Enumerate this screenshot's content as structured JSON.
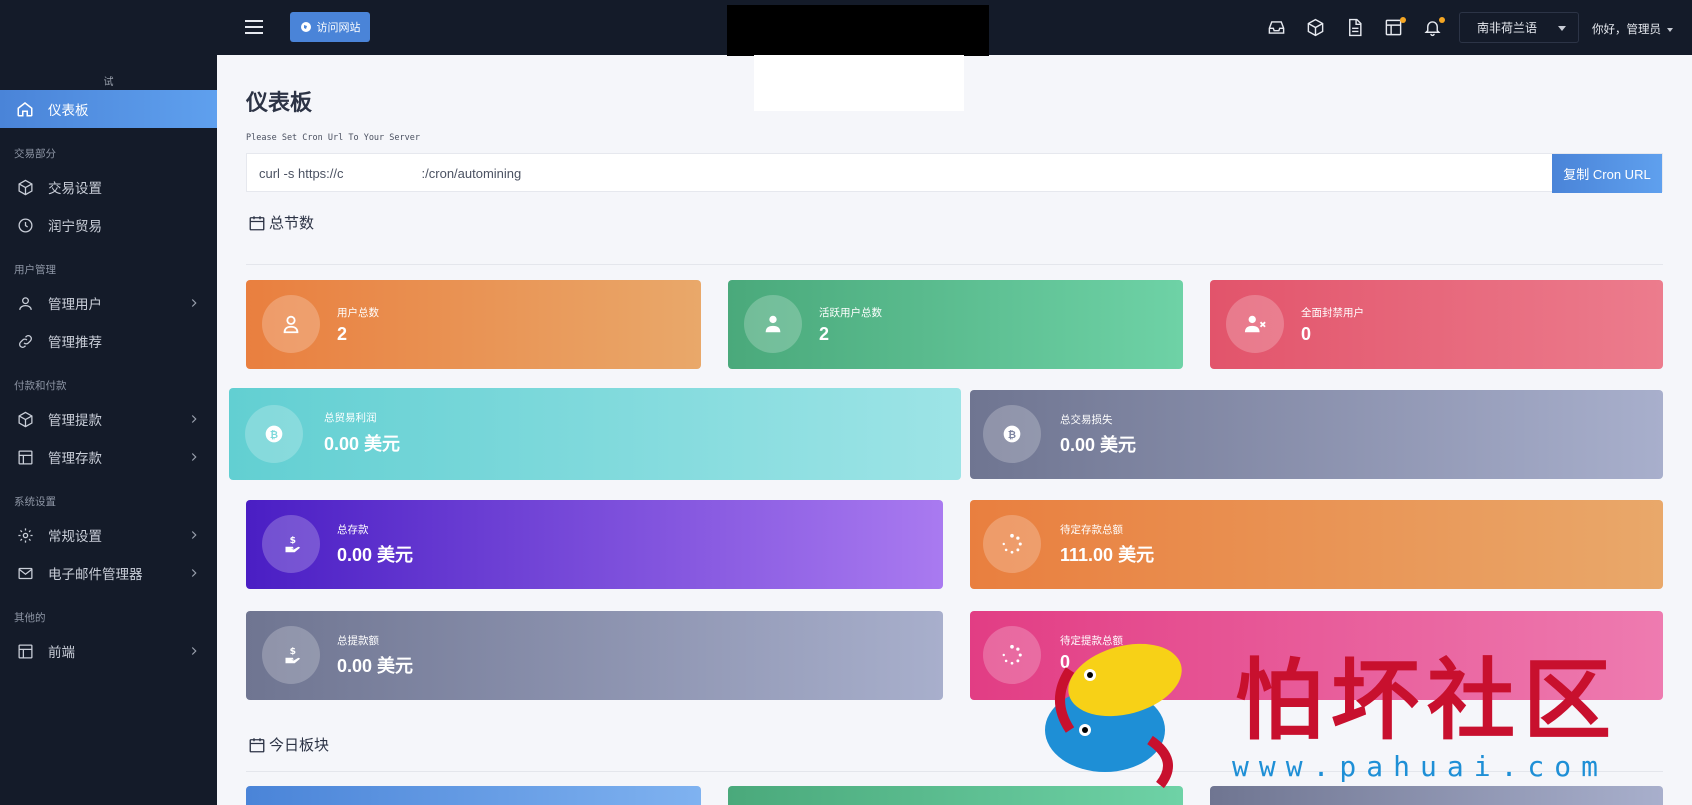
{
  "brand": {
    "label": "试"
  },
  "sidebar": {
    "active": {
      "label": "仪表板",
      "icon": "home-icon"
    },
    "sections": [
      {
        "title": "交易部分",
        "items": [
          {
            "label": "交易设置",
            "icon": "cube-icon",
            "chevron": false
          },
          {
            "label": "润宁贸易",
            "icon": "clock-icon",
            "chevron": false
          }
        ]
      },
      {
        "title": "用户管理",
        "items": [
          {
            "label": "管理用户",
            "icon": "user-icon",
            "chevron": true
          },
          {
            "label": "管理推荐",
            "icon": "link-icon",
            "chevron": false
          }
        ]
      },
      {
        "title": "付款和付款",
        "items": [
          {
            "label": "管理提款",
            "icon": "cube-icon",
            "chevron": true
          },
          {
            "label": "管理存款",
            "icon": "table-icon",
            "chevron": true
          }
        ]
      },
      {
        "title": "系统设置",
        "items": [
          {
            "label": "常规设置",
            "icon": "gear-icon",
            "chevron": true
          },
          {
            "label": "电子邮件管理器",
            "icon": "mail-icon",
            "chevron": true
          }
        ]
      },
      {
        "title": "其他的",
        "items": [
          {
            "label": "前端",
            "icon": "table-icon",
            "chevron": true
          }
        ]
      }
    ]
  },
  "topbar": {
    "visit_label": "访问网站",
    "language": "南非荷兰语",
    "greeting": "你好，管理员"
  },
  "page": {
    "title": "仪表板",
    "cron_note": "Please Set Cron Url To Your Server",
    "cron_prefix": "curl -s https://c",
    "cron_suffix": ":/cron/automining",
    "cron_button": "复制 Cron URL"
  },
  "totals": {
    "heading": "总节数",
    "cards": [
      {
        "label": "用户总数",
        "value": "2",
        "icon": "user-icon"
      },
      {
        "label": "活跃用户总数",
        "value": "2",
        "icon": "user-tie-icon"
      },
      {
        "label": "全面封禁用户",
        "value": "0",
        "icon": "user-x-icon"
      },
      {
        "label": "总贸易利润",
        "value": "0.00 美元",
        "icon": "bitcoin-icon"
      },
      {
        "label": "总交易损失",
        "value": "0.00 美元",
        "icon": "bitcoin-icon"
      },
      {
        "label": "总存款",
        "value": "0.00 美元",
        "icon": "hand-dollar-icon"
      },
      {
        "label": "待定存款总额",
        "value": "111.00 美元",
        "icon": "spinner-icon"
      },
      {
        "label": "总提款额",
        "value": "0.00 美元",
        "icon": "hand-dollar-icon"
      },
      {
        "label": "待定提款总额",
        "value": "0",
        "icon": "spinner-icon"
      }
    ]
  },
  "today": {
    "heading": "今日板块"
  },
  "watermark": {
    "title": "怕坏社区",
    "url": "www.pahuai.com"
  }
}
